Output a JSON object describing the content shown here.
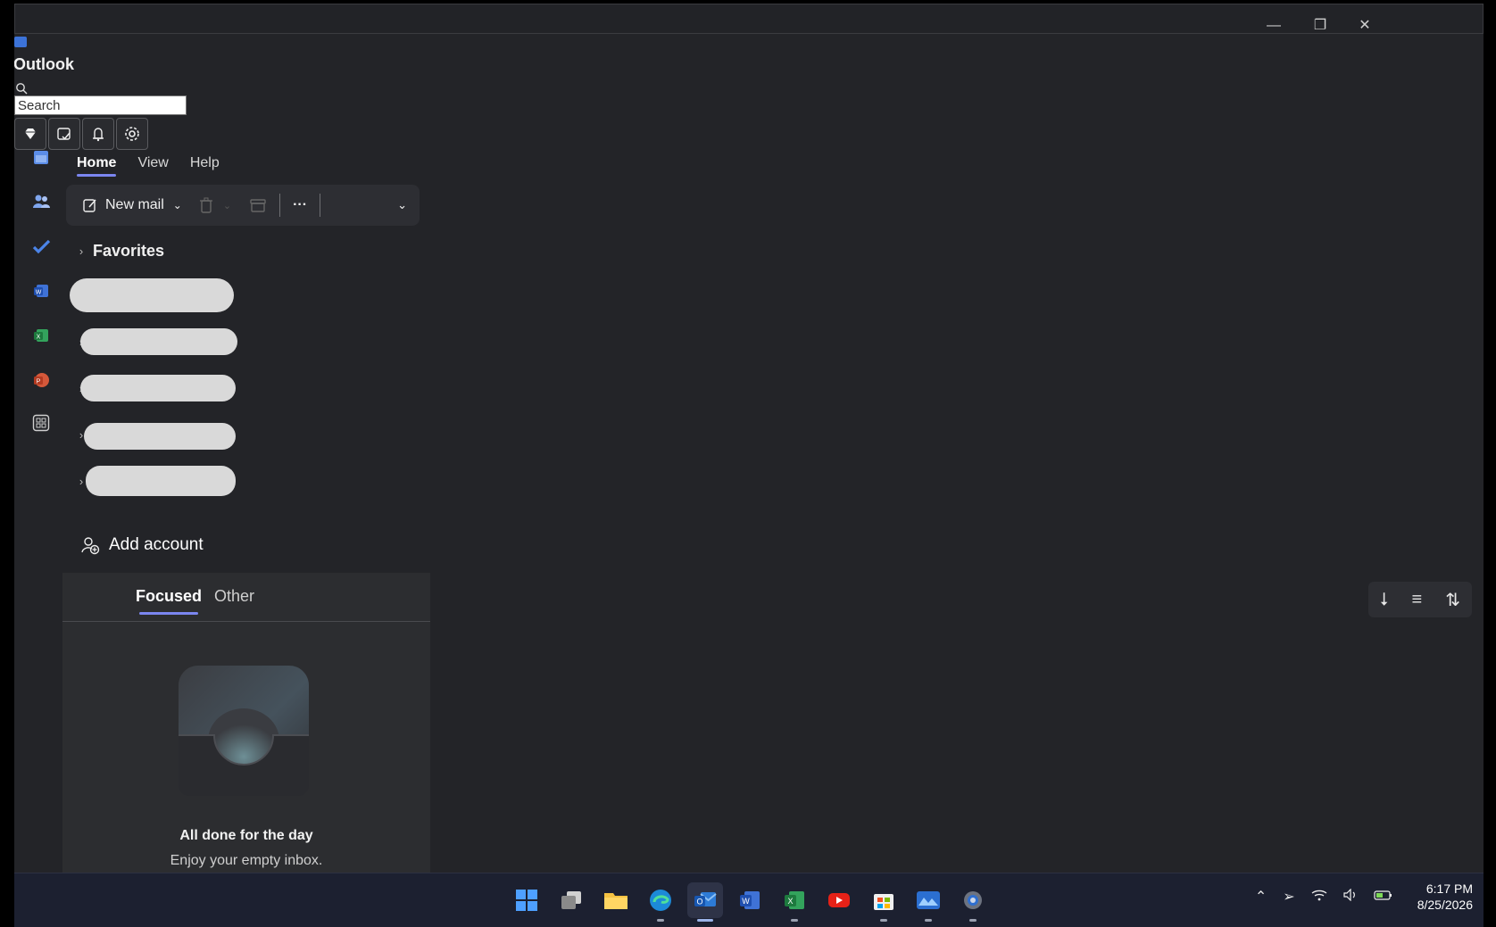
{
  "window": {
    "app_title": "Outlook",
    "minimize_glyph": "—",
    "restore_glyph": "❐",
    "close_glyph": "✕"
  },
  "search": {
    "value": "Search"
  },
  "quick_actions": [
    {
      "icon": "premium-diamond-icon"
    },
    {
      "icon": "my-day-icon"
    },
    {
      "icon": "whats-new-icon"
    },
    {
      "icon": "settings-icon"
    }
  ],
  "rail": [
    {
      "icon": "calendar-icon"
    },
    {
      "icon": "people-icon"
    },
    {
      "icon": "todo-icon"
    },
    {
      "icon": "word-icon"
    },
    {
      "icon": "excel-icon"
    },
    {
      "icon": "powerpoint-icon"
    },
    {
      "icon": "more-apps-icon"
    }
  ],
  "ribbon": {
    "tabs": [
      "Home",
      "View",
      "Help"
    ],
    "new_mail": "New mail",
    "more": "···"
  },
  "folders": {
    "favorites": "Favorites",
    "add_account": "Add account"
  },
  "inbox": {
    "tabs": [
      "Focused",
      "Other"
    ],
    "empty_title": "All done for the day",
    "empty_subtitle": "Enjoy your empty inbox."
  },
  "taskbar": {
    "apps": [
      "start",
      "task-view",
      "file-explorer",
      "edge",
      "outlook",
      "word",
      "excel",
      "youtube",
      "store",
      "photos",
      "settings"
    ],
    "time": "6:17 PM",
    "date": "8/25/2026"
  },
  "colors": {
    "accent": "#7b86f0",
    "window_bg": "#232428",
    "panel_bg": "#2c2d30"
  }
}
